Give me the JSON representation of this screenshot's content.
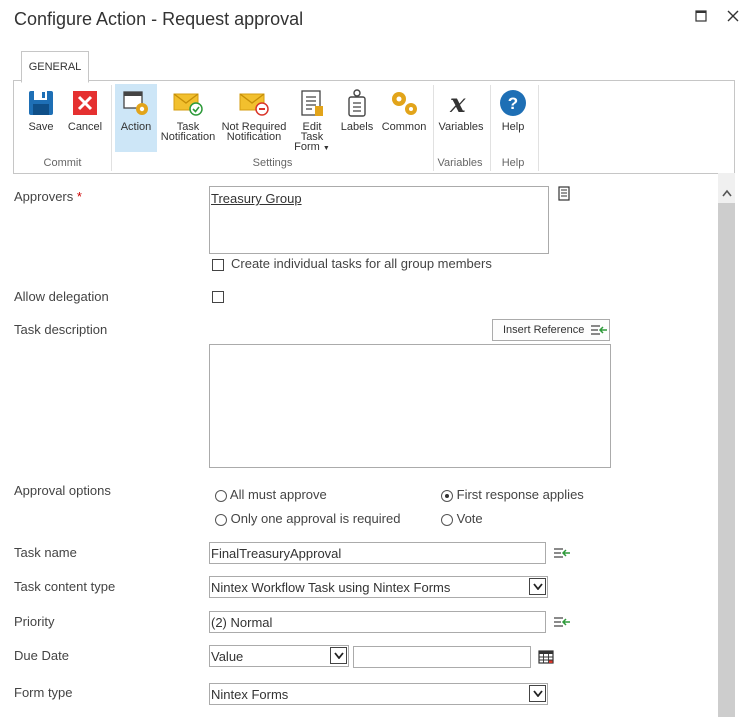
{
  "window": {
    "title": "Configure Action - Request approval",
    "maximize_icon": "maximize-icon",
    "close_icon": "close-icon"
  },
  "ribbon": {
    "tab_label": "GENERAL",
    "buttons": {
      "save": "Save",
      "cancel": "Cancel",
      "action": "Action",
      "task_notification_1": "Task",
      "task_notification_2": "Notification",
      "not_required_1": "Not Required",
      "not_required_2": "Notification",
      "edit_task_form_1": "Edit Task",
      "edit_task_form_2": "Form",
      "labels": "Labels",
      "common": "Common",
      "variables": "Variables",
      "help": "Help"
    },
    "groups": {
      "commit": "Commit",
      "settings": "Settings",
      "variables": "Variables",
      "help": "Help"
    }
  },
  "form": {
    "approvers": {
      "label": "Approvers",
      "required_mark": "*",
      "value": "Treasury Group",
      "individual_tasks_label": "Create individual tasks for all group members"
    },
    "allow_delegation": {
      "label": "Allow delegation"
    },
    "task_description": {
      "label": "Task description",
      "insert_reference": "Insert Reference",
      "value": ""
    },
    "approval_options": {
      "label": "Approval options",
      "options": [
        {
          "label": "All must approve",
          "selected": false
        },
        {
          "label": "First response applies",
          "selected": true
        },
        {
          "label": "Only one approval is required",
          "selected": false
        },
        {
          "label": "Vote",
          "selected": false
        }
      ]
    },
    "task_name": {
      "label": "Task name",
      "value": "FinalTreasuryApproval"
    },
    "task_content_type": {
      "label": "Task content type",
      "value": "Nintex Workflow Task using Nintex Forms"
    },
    "priority": {
      "label": "Priority",
      "value": "(2) Normal"
    },
    "due_date": {
      "label": "Due Date",
      "type_value": "Value",
      "date_value": ""
    },
    "form_type": {
      "label": "Form type",
      "value": "Nintex Forms"
    }
  }
}
